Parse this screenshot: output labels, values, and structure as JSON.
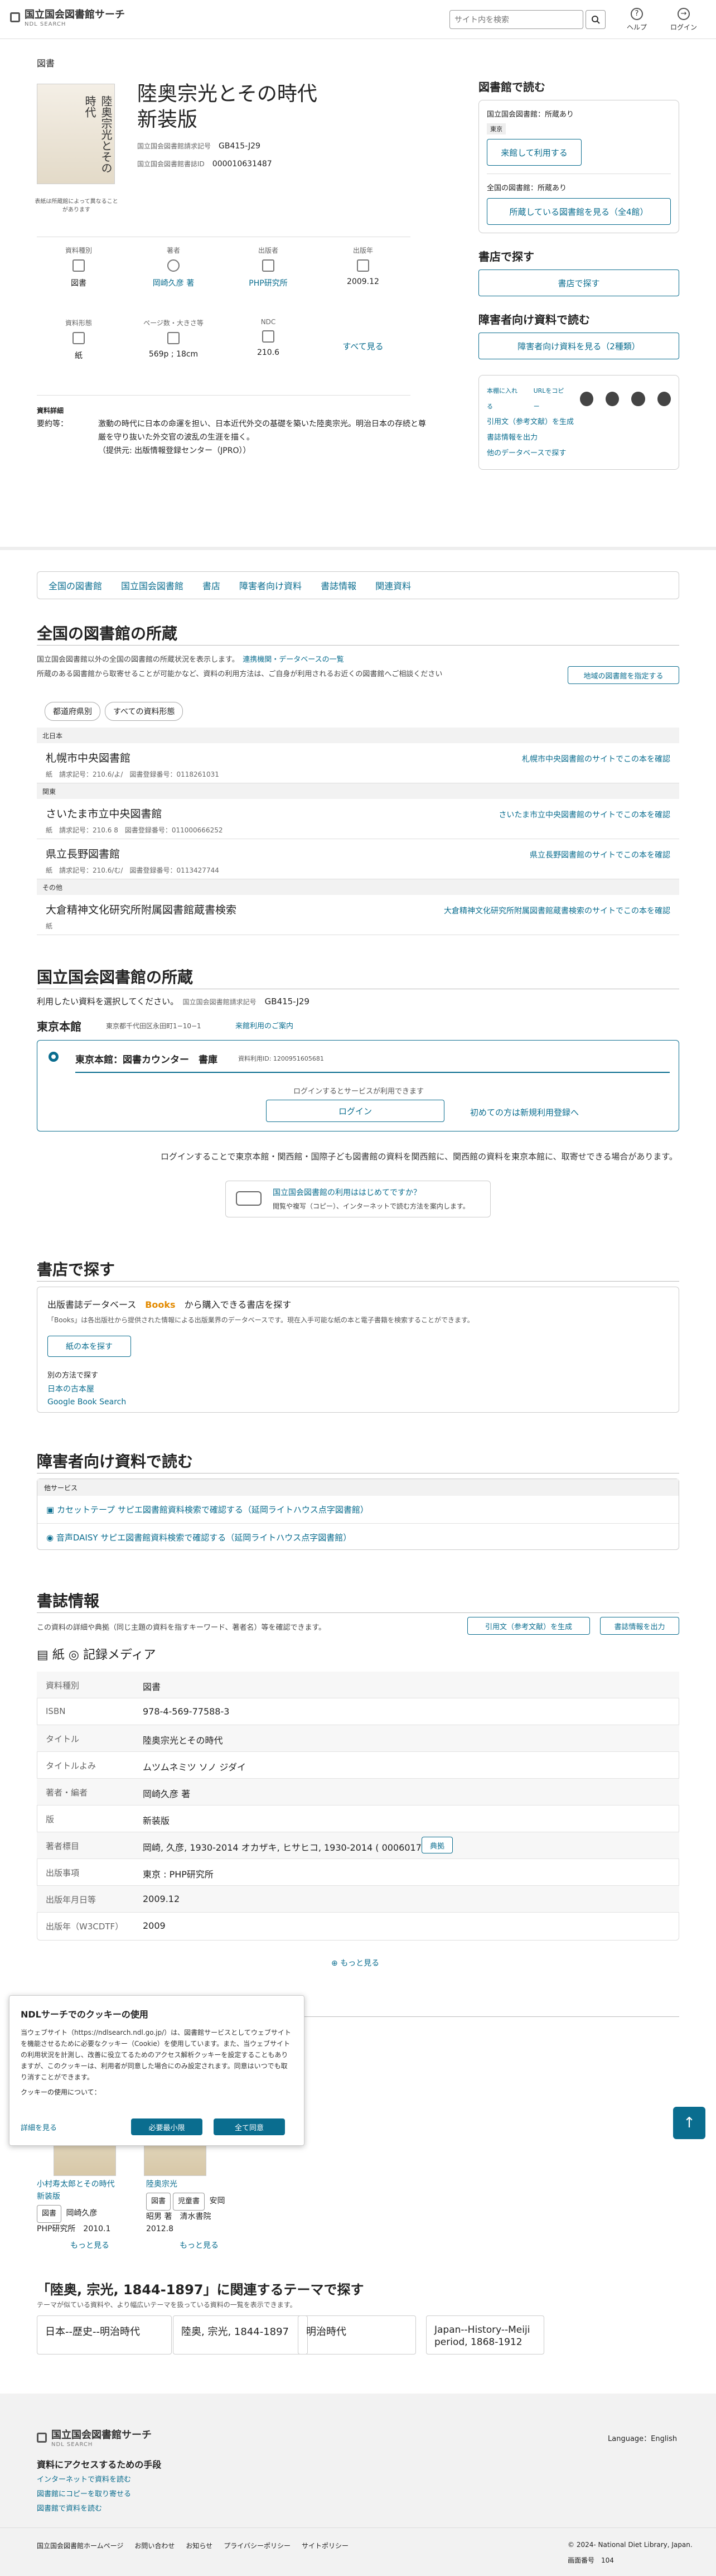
{
  "header": {
    "logo_title": "国立国会図書館サーチ",
    "logo_sub": "NDL SEARCH",
    "search_placeholder": "サイト内を検索",
    "help": "ヘルプ",
    "login": "ログイン"
  },
  "breadcrumb": "図書",
  "book": {
    "title1": "陸奥宗光とその時代",
    "title2": "新装版",
    "call_label": "国立国会図書館請求記号",
    "call": "GB415-J29",
    "bib_label": "国立国会図書館書誌ID",
    "bib": "000010631487",
    "cover_caption": "表紙は所蔵館によって異なることがあります",
    "cover_text": "陸奥宗光とその時代"
  },
  "grid": [
    {
      "k": "資料種別",
      "v": "図書"
    },
    {
      "k": "著者",
      "v": "岡崎久彦 著"
    },
    {
      "k": "出版者",
      "v": "PHP研究所"
    },
    {
      "k": "出版年",
      "v": "2009.12"
    },
    {
      "k": "資料形態",
      "v": "紙"
    },
    {
      "k": "ページ数・大きさ等",
      "v": "569p ; 18cm"
    },
    {
      "k": "NDC",
      "v": "210.6"
    }
  ],
  "see_all": "すべて見る",
  "detail": {
    "heading": "資料詳細",
    "label": "要約等：",
    "text": "激動の時代に日本の命運を担い、日本近代外交の基礎を築いた陸奥宗光。明治日本の存続と尊厳を守り抜いた外交官の波乱の生涯を描く。",
    "source": "（提供元: 出版情報登録センター（JPRO））"
  },
  "side": {
    "read_title": "図書館で読む",
    "ndl_label": "国立国会図書館：所蔵あり",
    "tokyo": "東京",
    "ndl_btn": "来館して利用する",
    "pub_label": "全国の図書館：所蔵あり",
    "pub_btn": "所蔵している図書館を見る（全4館）",
    "shop_title": "書店で探す",
    "shop_btn": "書店で探す",
    "dis_title": "障害者向け資料で読む",
    "dis_btn": "障害者向け資料を見る（2種類）",
    "share_left": "本棚に入れる",
    "share_right": "URLをコピー",
    "cite": "引用文（参考文献）を生成",
    "export": "書誌情報を出力",
    "other_db": "他のデータベースで探す"
  },
  "tabs": [
    "全国の図書館",
    "国立国会図書館",
    "書店",
    "障害者向け資料",
    "書誌情報",
    "関連資料"
  ],
  "national": {
    "title": "全国の図書館の所蔵",
    "note1": "国立国会図書館以外の全国の図書館の所蔵状況を表示します。",
    "link1": "連携機関・データベースの一覧",
    "note2": "所蔵のある図書館から取寄せることが可能かなど、資料の利用方法は、ご自身が利用されるお近くの図書館へご相談ください",
    "btn": "地域の図書館を指定する",
    "filter1": "都道府県別",
    "filter2": "すべての資料形態",
    "groups": [
      {
        "area": "北日本",
        "libs": [
          {
            "name": "札幌市中央図書館",
            "form": "紙",
            "call": "請求記号：210.6/よ/",
            "id": "図書登録番号：0118261031",
            "link": "札幌市中央図書館のサイトでこの本を確認"
          }
        ]
      },
      {
        "area": "関東",
        "libs": [
          {
            "name": "さいたま市立中央図書館",
            "form": "紙",
            "call": "請求記号：210.6 8",
            "id": "図書登録番号：011000666252",
            "link": "さいたま市立中央図書館のサイトでこの本を確認"
          },
          {
            "name": "県立長野図書館",
            "form": "紙",
            "call": "請求記号：210.6/む/",
            "id": "図書登録番号：0113427744",
            "link": "県立長野図書館のサイトでこの本を確認"
          }
        ]
      },
      {
        "area": "その他",
        "libs": [
          {
            "name": "大倉精神文化研究所附属図書館蔵書検索",
            "form": "紙",
            "call": "",
            "id": "",
            "link": "大倉精神文化研究所附属図書館蔵書検索のサイトでこの本を確認"
          }
        ]
      }
    ]
  },
  "ndl": {
    "title": "国立国会図書館の所蔵",
    "note": "利用したい資料を選択してください。",
    "call_label": "国立国会図書館請求記号",
    "call": "GB415-J29",
    "tokyo": "東京本館",
    "addr": "東京都千代田区永田町1−10−1",
    "guide": "来館利用のご案内",
    "counter": "東京本館：図書カウンター　書庫",
    "pid": "資料利用ID: 1200951605681",
    "login_note": "ログインするとサービスが利用できます",
    "login_btn": "ログイン",
    "register": "初めての方は新規利用登録へ",
    "apply_note": "ログインすることで東京本館・関西館・国際子ども図書館の資料を関西館に、関西館の資料を東京本館に、取寄せできる場合があります。",
    "first_title": "国立国会図書館の利用ははじめてですか？",
    "first_sub": "閲覧や複写（コピー）、インターネットで読む方法を案内します。"
  },
  "shop": {
    "title": "書店で探す",
    "db": "出版書誌データベース",
    "books": "Books",
    "buy": "から購入できる書店を探す",
    "desc": "「Books」は各出版社から提供された情報による出版業界のデータベースです。現在入手可能な紙の本と電子書籍を検索することができます。",
    "btn": "紙の本を探す",
    "alt": "別の方法で探す",
    "a1": "日本の古本屋",
    "a2": "Google Book Search"
  },
  "dis": {
    "title": "障害者向け資料で読む",
    "bar": "他サービス",
    "l1": "カセットテープ サピエ図書館資料検索で確認する（延岡ライトハウス点字図書館）",
    "l2": "音声DAISY サピエ図書館資料検索で確認する（延岡ライトハウス点字図書館）"
  },
  "biblio": {
    "title": "書誌情報",
    "note": "この資料の詳細や典拠（同じ主題の資料を指すキーワード、著者名）等を確認できます。",
    "cite": "引用文（参考文献）を生成",
    "export": "書誌情報を出力",
    "media": "紙",
    "media2": "記録メディア",
    "rows": [
      {
        "k": "資料種別",
        "v": "図書"
      },
      {
        "k": "ISBN",
        "v": "978-4-569-77588-3"
      },
      {
        "k": "タイトル",
        "v": "陸奥宗光とその時代"
      },
      {
        "k": "タイトルよみ",
        "v": "ムツムネミツ ソノ ジダイ"
      },
      {
        "k": "著者・編者",
        "v": "岡崎久彦 著"
      },
      {
        "k": "版",
        "v": "新装版"
      },
      {
        "k": "著者標目",
        "v": "岡崎, 久彦, 1930-2014 オカザキ, ヒサヒコ, 1930-2014 ( 00060178 )"
      },
      {
        "k": "出版事項",
        "v": "東京 : PHP研究所"
      },
      {
        "k": "出版年月日等",
        "v": "2009.12"
      },
      {
        "k": "出版年（W3CDTF）",
        "v": "2009"
      }
    ],
    "author_btn": "典拠",
    "more": "もっと見る"
  },
  "cookie": {
    "title": "NDLサーチでのクッキーの使用",
    "body": "当ウェブサイト（https://ndlsearch.ndl.go.jp/）は、図書館サービスとしてウェブサイトを機能させるために必要なクッキー（Cookie）を使用しています。また、当ウェブサイトの利用状況を計測し、改善に役立てるためのアクセス解析クッキーを設定することもありますが、このクッキーは、利用者が同意した場合にのみ設定されます。同意はいつでも取り消すことができます。",
    "q": "クッキーの使用について：",
    "detail": "詳細を見る",
    "min": "必要最小限",
    "all": "全て同意"
  },
  "related": [
    {
      "title1": "小村寿太郎とその時代",
      "title2": "新装版",
      "t1": "図書",
      "author": "岡崎久彦",
      "pub": "PHP研究所",
      "year": "2010.1",
      "more": "もっと見る"
    },
    {
      "title1": "陸奥宗光",
      "t1": "図書",
      "t2": "児童書",
      "author": "安岡",
      "author2": "昭男 著",
      "pub": "清水書院",
      "year": "2012.8",
      "more": "もっと見る"
    }
  ],
  "themes": {
    "title": "「陸奥, 宗光, 1844-1897」に関連するテーマで探す",
    "sub": "テーマが似ている資料や、より幅広いテーマを扱っている資料の一覧を表示できます。",
    "items": [
      "日本--歴史--明治時代",
      "陸奥, 宗光, 1844-1897",
      "明治時代",
      "Japan--History--Meiji period, 1868-1912"
    ]
  },
  "footer": {
    "logo": "国立国会図書館サーチ",
    "sub": "NDL SEARCH",
    "lang": "Language：English",
    "head": "資料にアクセスするための手段",
    "l1": "インターネットで資料を読む",
    "l2": "図書館にコピーを取り寄せる",
    "l3": "図書館で資料を読む",
    "links": [
      "国立国会図書館ホームページ",
      "お問い合わせ",
      "お知らせ",
      "プライバシーポリシー",
      "サイトポリシー"
    ],
    "copy": "© 2024- National Diet Library, Japan.",
    "page": "画面番号",
    "pno": "104"
  }
}
